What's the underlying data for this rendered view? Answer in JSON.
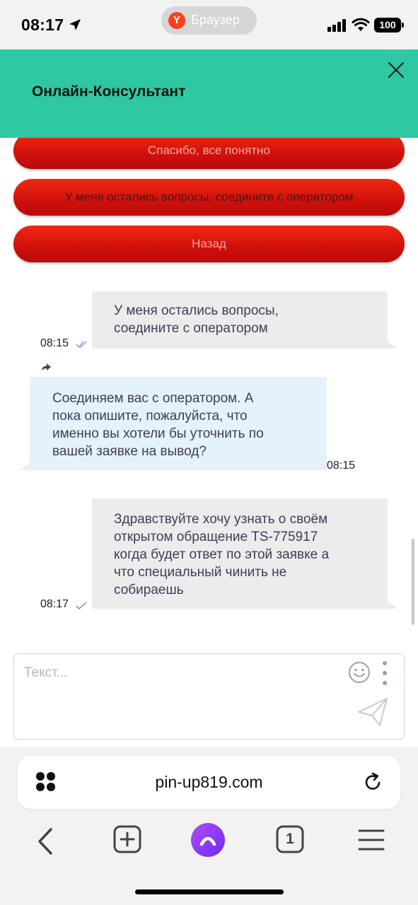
{
  "status_bar": {
    "time": "08:17",
    "app_name": "Браузер",
    "battery": "100"
  },
  "header": {
    "title": "Онлайн-Консультант"
  },
  "quick_replies": [
    {
      "label": "Спасибо, все понятно"
    },
    {
      "label": "У меня остались вопросы, соедините с оператором"
    },
    {
      "label": "Назад"
    }
  ],
  "messages": [
    {
      "lines": [
        "У меня остались вопросы,",
        "соедините с оператором"
      ],
      "time": "08:15"
    },
    {
      "lines": [
        "Соединяем вас с оператором. А",
        "пока опишите, пожалуйста, что",
        "именно вы хотели бы уточнить по",
        "вашей заявке на вывод?"
      ],
      "time": "08:15"
    },
    {
      "lines": [
        "Здравствуйте хочу узнать о своём",
        "открытом обращение TS-775917",
        "когда будет ответ по этой заявке а",
        "что специальный чинить не",
        "собираешь"
      ],
      "time": "08:17"
    }
  ],
  "input": {
    "placeholder": "Текст..."
  },
  "browser": {
    "url": "pin-up819.com",
    "tab_count": "1"
  },
  "colors": {
    "header_bg": "#2ec8a3",
    "quick_reply_bg": "#d0100c",
    "outgoing_bubble": "#ececec",
    "incoming_bubble": "#e5f1fb"
  },
  "icons": [
    "location-arrow-icon",
    "signal-icon",
    "wifi-icon",
    "close-icon",
    "read-receipt-icon",
    "forward-icon",
    "sent-check-icon",
    "emoji-icon",
    "more-vertical-icon",
    "send-icon",
    "tabs-grid-icon",
    "reload-icon",
    "back-icon",
    "new-tab-icon",
    "alice-icon",
    "tab-counter-icon",
    "menu-icon"
  ]
}
